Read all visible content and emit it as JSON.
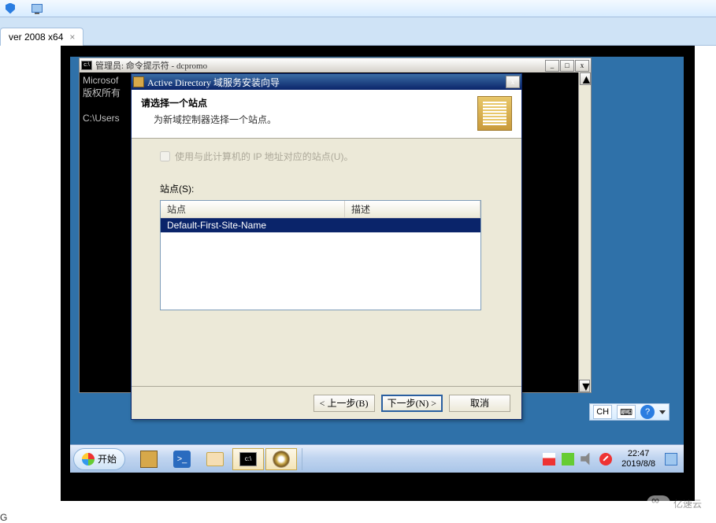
{
  "topbar": {
    "icons": [
      "shield",
      "monitor"
    ]
  },
  "vm_tab": {
    "label": "ver 2008 x64",
    "close": "×"
  },
  "cmd": {
    "title": "管理员: 命令提示符 - dcpromo",
    "lines": [
      "Microsof",
      "版权所有",
      "",
      "C:\\Users"
    ],
    "btn_min": "_",
    "btn_max": "□",
    "btn_close": "x"
  },
  "wizard": {
    "title": "Active Directory 域服务安装向导",
    "close": "x",
    "heading": "请选择一个站点",
    "subheading": "为新域控制器选择一个站点。",
    "checkbox_label": "使用与此计算机的 IP 地址对应的站点(U)。",
    "sites_label": "站点(S):",
    "cols": {
      "a": "站点",
      "b": "描述"
    },
    "rows": [
      {
        "site": "Default-First-Site-Name",
        "desc": ""
      }
    ],
    "btn_back": "< 上一步(B)",
    "btn_next": "下一步(N) >",
    "btn_cancel": "取消"
  },
  "taskbar": {
    "start": "开始",
    "ql": [
      "server-manager",
      "powershell",
      "explorer",
      "cmd",
      "media"
    ],
    "lang": "CH",
    "ime_kb": "⌨",
    "clock_time": "22:47",
    "clock_date": "2019/8/8"
  },
  "watermark": "亿速云",
  "bottom_left": "G"
}
